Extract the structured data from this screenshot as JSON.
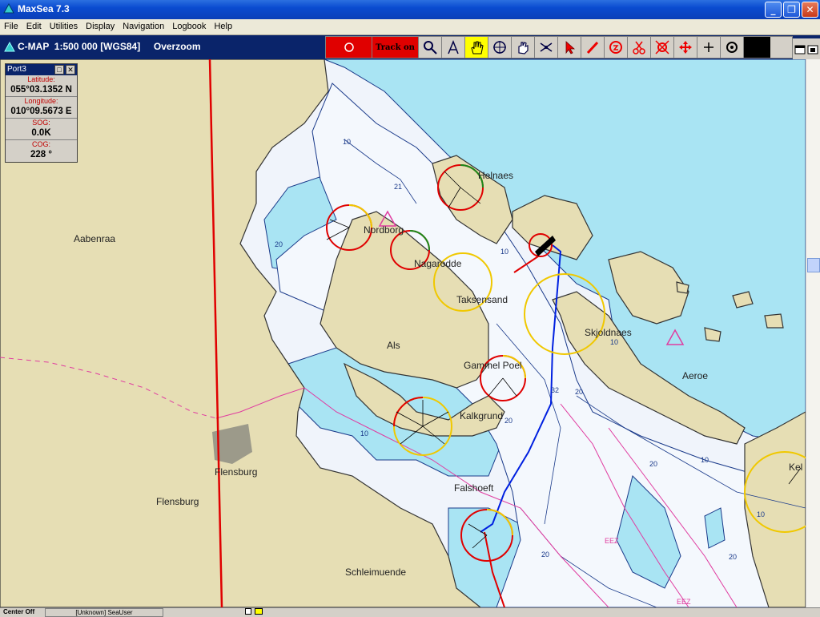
{
  "window": {
    "title": "MaxSea 7.3",
    "buttons": [
      "_",
      "❐",
      "✕"
    ]
  },
  "menu": [
    "File",
    "Edit",
    "Utilities",
    "Display",
    "Navigation",
    "Logbook",
    "Help"
  ],
  "chart_header": {
    "source": "C-MAP",
    "scale": "1:500 000",
    "datum": "[WGS84]",
    "mode": "Overzoom"
  },
  "toolbar": {
    "track_label": "Track on"
  },
  "panel": {
    "title": "Port3",
    "fields": [
      {
        "label": "Latitude:",
        "value": "055°03.1352 N"
      },
      {
        "label": "Longitude:",
        "value": "010°09.5673 E"
      },
      {
        "label": "SOG:",
        "value": "0.0K"
      },
      {
        "label": "COG:",
        "value": "228 °"
      }
    ]
  },
  "places": [
    "Aabenraa",
    "Helnaes",
    "Nordborg",
    "Nagarodde",
    "Taksensand",
    "Als",
    "Skjoldnaes",
    "Aeroe",
    "Gammel Poel",
    "Kalkgrund",
    "Flensburg",
    "Flensburg",
    "Falshoeft",
    "Schleimuende",
    "Kel"
  ],
  "depths": [
    "10",
    "21",
    "20",
    "10",
    "10",
    "20",
    "10",
    "10",
    "20",
    "20",
    "20",
    "10",
    "32",
    "20",
    "EEZ",
    "EEZ"
  ],
  "statusbar": {
    "left": "Center Off",
    "user": "[Unknown] SeaUser"
  }
}
